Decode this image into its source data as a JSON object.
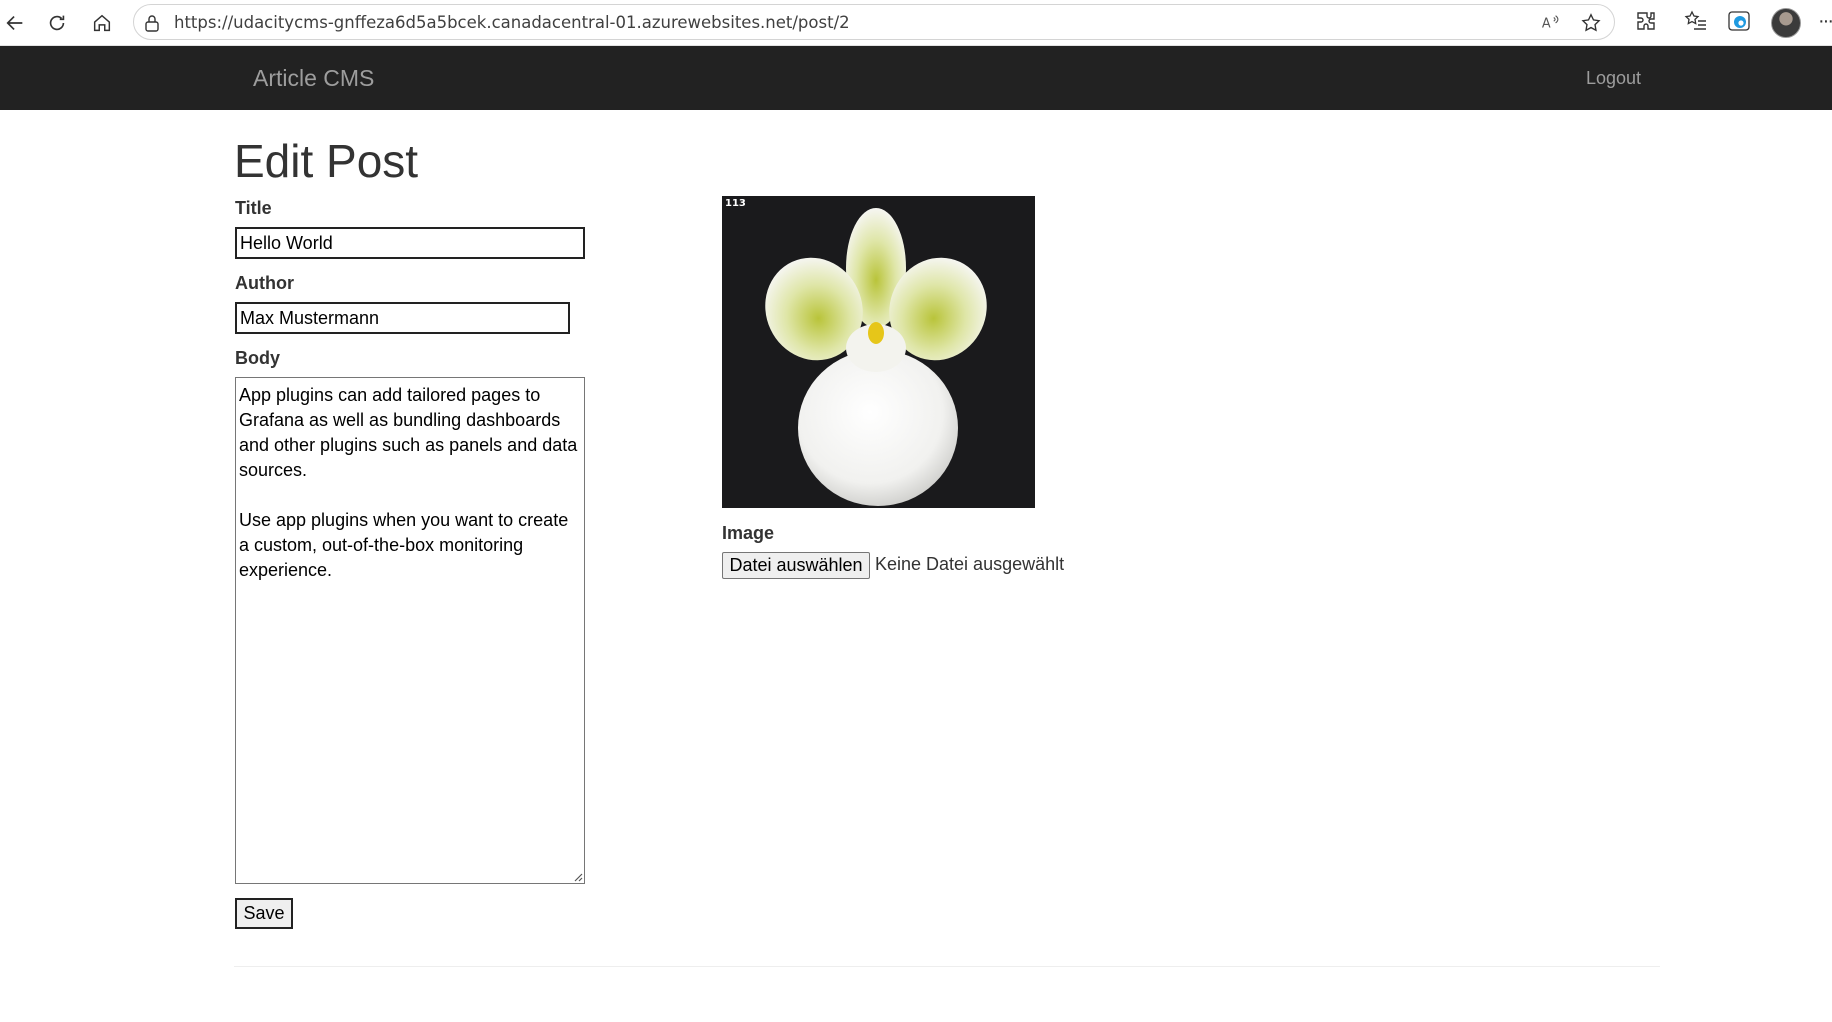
{
  "browser": {
    "url": "https://udacitycms-gnffeza6d5a5bcek.canadacentral-01.azurewebsites.net/post/2"
  },
  "navbar": {
    "brand": "Article CMS",
    "logout_label": "Logout"
  },
  "page": {
    "title": "Edit Post"
  },
  "form": {
    "title_label": "Title",
    "title_value": "Hello World",
    "author_label": "Author",
    "author_value": "Max Mustermann",
    "body_label": "Body",
    "body_value": "App plugins can add tailored pages to Grafana as well as bundling dashboards and other plugins such as panels and data sources.\n\nUse app plugins when you want to create a custom, out-of-the-box monitoring experience.",
    "save_label": "Save",
    "image_label": "Image",
    "image_number": "113",
    "file_button_label": "Datei auswählen",
    "file_status": "Keine Datei ausgewählt"
  },
  "icons": {
    "back": "arrow-left-icon",
    "refresh": "refresh-icon",
    "home": "home-icon",
    "lock": "lock-icon",
    "read_aloud": "read-aloud-icon",
    "favorite": "star-icon",
    "extensions": "puzzle-icon",
    "favorites_list": "favorites-list-icon",
    "edge": "edge-icon",
    "more": "more-icon"
  },
  "colors": {
    "navbar_bg": "#222222",
    "navbar_text": "#9d9d9d",
    "text": "#333333"
  }
}
